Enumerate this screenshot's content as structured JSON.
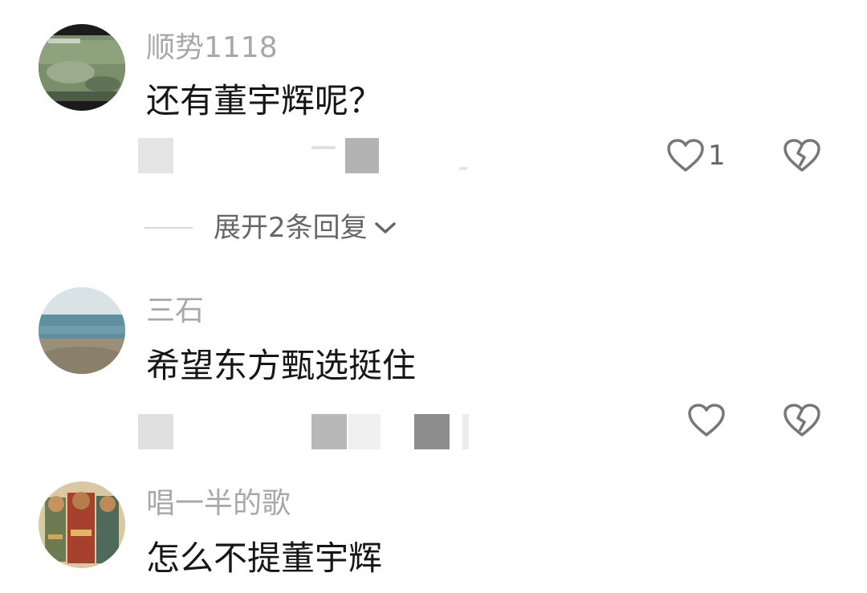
{
  "comments": [
    {
      "username": "顺势1118",
      "text": "还有董宇辉呢？",
      "like_count": "1",
      "icons": {
        "like": "heart-outline-icon",
        "dislike": "broken-heart-icon"
      }
    },
    {
      "username": "三石",
      "text": "希望东方甄选挺住",
      "like_count": "",
      "icons": {
        "like": "heart-outline-icon",
        "dislike": "broken-heart-icon"
      }
    },
    {
      "username": "唱一半的歌",
      "text": "怎么不提董宇辉",
      "like_count": ""
    }
  ],
  "expand_replies": {
    "label": "展开2条回复",
    "icon": "chevron-down-icon"
  },
  "colors": {
    "username": "#a8a8a8",
    "text": "#161616",
    "icon": "#777777"
  }
}
